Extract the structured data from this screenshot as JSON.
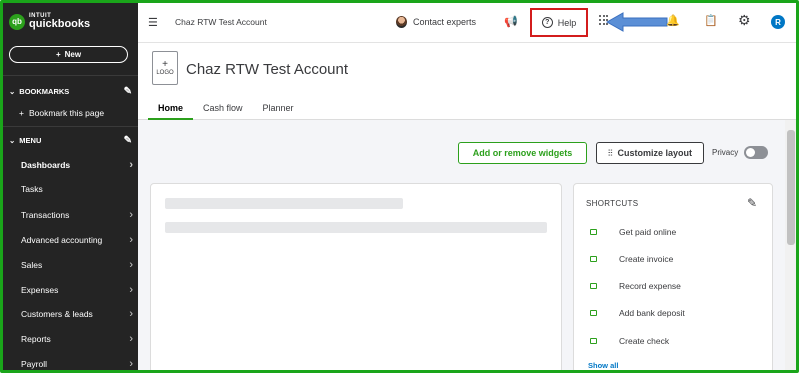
{
  "brand": {
    "badge": "qb",
    "intuit": "INTUIT",
    "name": "quickbooks"
  },
  "sidebar": {
    "new_label": "New",
    "bookmarks_title": "BOOKMARKS",
    "bookmark_this_page": "Bookmark this page",
    "menu_title": "MENU",
    "items": [
      {
        "label": "Dashboards",
        "chevron": true,
        "bold": true
      },
      {
        "label": "Tasks",
        "chevron": false
      },
      {
        "label": "Transactions",
        "chevron": true
      },
      {
        "label": "Advanced accounting",
        "chevron": true
      },
      {
        "label": "Sales",
        "chevron": true
      },
      {
        "label": "Expenses",
        "chevron": true
      },
      {
        "label": "Customers & leads",
        "chevron": true
      },
      {
        "label": "Reports",
        "chevron": true
      },
      {
        "label": "Payroll",
        "chevron": true
      }
    ]
  },
  "topbar": {
    "company_name": "Chaz RTW Test Account",
    "contact_experts": "Contact experts",
    "help": "Help",
    "user_initial": "R",
    "highlight_color": "#d31c1c",
    "arrow_color": "#5b8fd6"
  },
  "header": {
    "logo_placeholder": "LOGO",
    "logo_plus": "+",
    "company_title": "Chaz RTW Test Account",
    "tabs": [
      {
        "label": "Home",
        "active": true
      },
      {
        "label": "Cash flow",
        "active": false
      },
      {
        "label": "Planner",
        "active": false
      }
    ]
  },
  "main": {
    "add_remove_widgets": "Add or remove widgets",
    "customize_layout": "Customize layout",
    "privacy": "Privacy",
    "privacy_on": false
  },
  "shortcuts": {
    "title": "SHORTCUTS",
    "items": [
      "Get paid online",
      "Create invoice",
      "Record expense",
      "Add bank deposit",
      "Create check"
    ],
    "show_all": "Show all"
  },
  "colors": {
    "accent_green": "#2ca01c",
    "sidebar_bg": "#242424",
    "frame_border": "#1aa51a",
    "link_blue": "#0077c5"
  }
}
